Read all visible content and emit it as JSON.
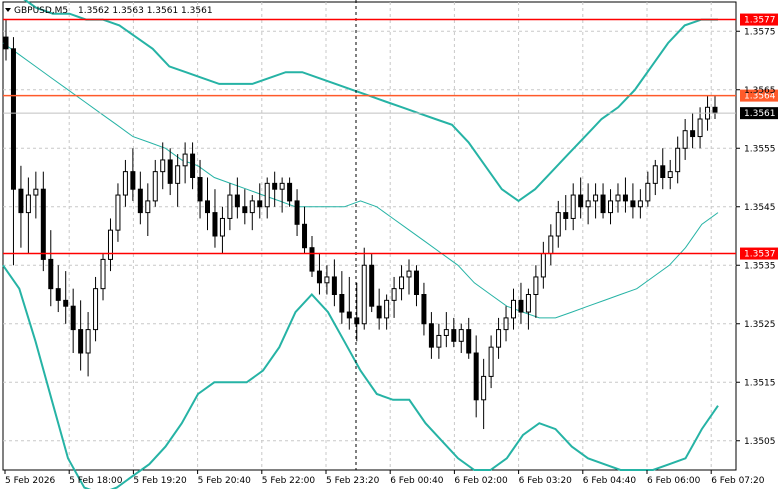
{
  "header": {
    "symbol": "GBPUSD,M5",
    "ohlc": "1.3562 1.3563 1.3561 1.3561"
  },
  "chart_data": {
    "type": "candlestick",
    "symbol": "GBPUSD",
    "timeframe": "M5",
    "ylim": [
      1.35,
      1.358
    ],
    "grid": true,
    "y_ticks": [
      "1.3575",
      "1.3565",
      "1.3555",
      "1.3545",
      "1.3535",
      "1.3525",
      "1.3515",
      "1.3505"
    ],
    "x_ticks": [
      "5 Feb 2026",
      "5 Feb 18:00",
      "5 Feb 19:20",
      "5 Feb 20:40",
      "5 Feb 22:00",
      "5 Feb 23:20",
      "6 Feb 00:40",
      "6 Feb 02:00",
      "6 Feb 03:20",
      "6 Feb 04:40",
      "6 Feb 06:00",
      "6 Feb 07:20"
    ],
    "horizontal_levels": [
      {
        "value": 1.3577,
        "label": "1.3577",
        "color": "#ff0000"
      },
      {
        "value": 1.3564,
        "label": "1.3564",
        "color": "#ff5a2a"
      },
      {
        "value": 1.3537,
        "label": "1.3537",
        "color": "#ff0000"
      }
    ],
    "bid_line": {
      "value": 1.3561,
      "label": "1.3561",
      "color": "#c0c0c0"
    },
    "candle_colors": {
      "body": "#000000",
      "wick": "#000000",
      "bull_fill": "#ffffff"
    },
    "indicators": {
      "upper_band": {
        "color": "#26b3a5",
        "values": [
          1.3583,
          1.3581,
          1.3579,
          1.3578,
          1.3578,
          1.3577,
          1.3577,
          1.3576,
          1.3574,
          1.3572,
          1.3569,
          1.3568,
          1.3567,
          1.3566,
          1.3566,
          1.3566,
          1.3567,
          1.3568,
          1.3568,
          1.3567,
          1.3566,
          1.3565,
          1.3564,
          1.3563,
          1.3562,
          1.3561,
          1.356,
          1.3559,
          1.3556,
          1.3552,
          1.3548,
          1.3546,
          1.3548,
          1.3551,
          1.3554,
          1.3557,
          1.356,
          1.3562,
          1.3565,
          1.3569,
          1.3573,
          1.3576,
          1.3577,
          1.3577
        ]
      },
      "middle_band": {
        "color": "#26b3a5",
        "values": [
          1.3573,
          1.3571,
          1.3569,
          1.3567,
          1.3565,
          1.3563,
          1.3561,
          1.3559,
          1.3557,
          1.3556,
          1.3555,
          1.3553,
          1.3552,
          1.355,
          1.3549,
          1.3548,
          1.3547,
          1.3546,
          1.3545,
          1.3545,
          1.3545,
          1.3545,
          1.3546,
          1.3545,
          1.3543,
          1.3541,
          1.3539,
          1.3537,
          1.3535,
          1.3532,
          1.353,
          1.3528,
          1.3527,
          1.3526,
          1.3526,
          1.3527,
          1.3528,
          1.3529,
          1.353,
          1.3531,
          1.3533,
          1.3535,
          1.3538,
          1.3542,
          1.3544
        ]
      },
      "lower_band": {
        "color": "#26b3a5",
        "values": [
          1.3535,
          1.3531,
          1.3522,
          1.3512,
          1.3502,
          1.3497,
          1.3496,
          1.3497,
          1.3499,
          1.3501,
          1.3504,
          1.3508,
          1.3513,
          1.3515,
          1.3515,
          1.3515,
          1.3517,
          1.3521,
          1.3527,
          1.353,
          1.3527,
          1.3522,
          1.3517,
          1.3513,
          1.3512,
          1.3512,
          1.3508,
          1.3505,
          1.3502,
          1.35,
          1.35,
          1.3502,
          1.3506,
          1.3508,
          1.3507,
          1.3504,
          1.3502,
          1.3501,
          1.35,
          1.35,
          1.35,
          1.3501,
          1.3502,
          1.3507,
          1.3511
        ]
      }
    },
    "candles": [
      [
        1.3574,
        1.3577,
        1.357,
        1.3572
      ],
      [
        1.3572,
        1.3574,
        1.3535,
        1.3548
      ],
      [
        1.3548,
        1.3552,
        1.3538,
        1.3544
      ],
      [
        1.3544,
        1.355,
        1.3537,
        1.3547
      ],
      [
        1.3547,
        1.3551,
        1.3543,
        1.3548
      ],
      [
        1.3548,
        1.3551,
        1.3534,
        1.3536
      ],
      [
        1.3536,
        1.3541,
        1.3528,
        1.3531
      ],
      [
        1.3531,
        1.3535,
        1.3527,
        1.3529
      ],
      [
        1.3529,
        1.3534,
        1.3525,
        1.3528
      ],
      [
        1.3528,
        1.3531,
        1.352,
        1.3524
      ],
      [
        1.3524,
        1.3529,
        1.3517,
        1.352
      ],
      [
        1.352,
        1.3527,
        1.3516,
        1.3524
      ],
      [
        1.3524,
        1.3533,
        1.3522,
        1.3531
      ],
      [
        1.3531,
        1.3537,
        1.3529,
        1.3536
      ],
      [
        1.3536,
        1.3543,
        1.3534,
        1.3541
      ],
      [
        1.3541,
        1.3549,
        1.3539,
        1.3547
      ],
      [
        1.3547,
        1.3553,
        1.3545,
        1.3551
      ],
      [
        1.3551,
        1.3555,
        1.3546,
        1.3548
      ],
      [
        1.3548,
        1.3551,
        1.3542,
        1.3544
      ],
      [
        1.3544,
        1.3549,
        1.354,
        1.3546
      ],
      [
        1.3546,
        1.3553,
        1.3545,
        1.3551
      ],
      [
        1.3551,
        1.3556,
        1.3548,
        1.3553
      ],
      [
        1.3553,
        1.3555,
        1.3547,
        1.3549
      ],
      [
        1.3549,
        1.3554,
        1.3545,
        1.3552
      ],
      [
        1.3552,
        1.3556,
        1.3549,
        1.3554
      ],
      [
        1.3554,
        1.3556,
        1.3548,
        1.355
      ],
      [
        1.355,
        1.3553,
        1.3543,
        1.3546
      ],
      [
        1.3546,
        1.355,
        1.3541,
        1.3544
      ],
      [
        1.3544,
        1.3548,
        1.3538,
        1.354
      ],
      [
        1.354,
        1.3545,
        1.3537,
        1.3543
      ],
      [
        1.3543,
        1.3549,
        1.3541,
        1.3547
      ],
      [
        1.3547,
        1.355,
        1.3543,
        1.3545
      ],
      [
        1.3545,
        1.3548,
        1.3542,
        1.3544
      ],
      [
        1.3544,
        1.3547,
        1.3541,
        1.3546
      ],
      [
        1.3546,
        1.3549,
        1.3543,
        1.3545
      ],
      [
        1.3545,
        1.355,
        1.3543,
        1.3549
      ],
      [
        1.3549,
        1.3551,
        1.3545,
        1.3548
      ],
      [
        1.3548,
        1.355,
        1.3544,
        1.3549
      ],
      [
        1.3549,
        1.355,
        1.3545,
        1.3546
      ],
      [
        1.3546,
        1.3548,
        1.354,
        1.3542
      ],
      [
        1.3542,
        1.3545,
        1.3537,
        1.3538
      ],
      [
        1.3538,
        1.354,
        1.3533,
        1.3534
      ],
      [
        1.3534,
        1.3537,
        1.353,
        1.3532
      ],
      [
        1.3532,
        1.3535,
        1.353,
        1.3533
      ],
      [
        1.3533,
        1.3536,
        1.3528,
        1.353
      ],
      [
        1.353,
        1.3534,
        1.3525,
        1.3527
      ],
      [
        1.3527,
        1.3533,
        1.3524,
        1.3526
      ],
      [
        1.3526,
        1.3532,
        1.3522,
        1.3525
      ],
      [
        1.3525,
        1.3538,
        1.3524,
        1.3535
      ],
      [
        1.3535,
        1.3537,
        1.3527,
        1.3528
      ],
      [
        1.3528,
        1.3531,
        1.3524,
        1.3526
      ],
      [
        1.3526,
        1.353,
        1.3524,
        1.3529
      ],
      [
        1.3529,
        1.3533,
        1.3526,
        1.3531
      ],
      [
        1.3531,
        1.3535,
        1.3529,
        1.3533
      ],
      [
        1.3533,
        1.3536,
        1.353,
        1.3534
      ],
      [
        1.3534,
        1.3535,
        1.3528,
        1.353
      ],
      [
        1.353,
        1.3532,
        1.3523,
        1.3525
      ],
      [
        1.3525,
        1.3527,
        1.3519,
        1.3521
      ],
      [
        1.3521,
        1.3525,
        1.3519,
        1.3523
      ],
      [
        1.3523,
        1.3527,
        1.3521,
        1.3524
      ],
      [
        1.3524,
        1.3526,
        1.3521,
        1.3522
      ],
      [
        1.3522,
        1.3525,
        1.352,
        1.3524
      ],
      [
        1.3524,
        1.3526,
        1.3519,
        1.352
      ],
      [
        1.352,
        1.3523,
        1.3509,
        1.3512
      ],
      [
        1.3512,
        1.3519,
        1.3507,
        1.3516
      ],
      [
        1.3516,
        1.3523,
        1.3514,
        1.3521
      ],
      [
        1.3521,
        1.3526,
        1.3519,
        1.3524
      ],
      [
        1.3524,
        1.3528,
        1.3522,
        1.3526
      ],
      [
        1.3526,
        1.3531,
        1.3524,
        1.3529
      ],
      [
        1.3529,
        1.3532,
        1.3525,
        1.3527
      ],
      [
        1.3527,
        1.3531,
        1.3524,
        1.353
      ],
      [
        1.353,
        1.3535,
        1.3526,
        1.3533
      ],
      [
        1.3533,
        1.3539,
        1.3531,
        1.3537
      ],
      [
        1.3537,
        1.3542,
        1.3535,
        1.354
      ],
      [
        1.354,
        1.3546,
        1.3538,
        1.3544
      ],
      [
        1.3544,
        1.3547,
        1.3541,
        1.3543
      ],
      [
        1.3543,
        1.3549,
        1.3541,
        1.3547
      ],
      [
        1.3547,
        1.355,
        1.3543,
        1.3545
      ],
      [
        1.3545,
        1.3549,
        1.3542,
        1.3546
      ],
      [
        1.3546,
        1.3549,
        1.3543,
        1.3547
      ],
      [
        1.3547,
        1.3549,
        1.3543,
        1.3544
      ],
      [
        1.3544,
        1.3548,
        1.3542,
        1.3546
      ],
      [
        1.3546,
        1.3549,
        1.3544,
        1.3547
      ],
      [
        1.3547,
        1.355,
        1.3544,
        1.3546
      ],
      [
        1.3546,
        1.3549,
        1.3543,
        1.3545
      ],
      [
        1.3545,
        1.3548,
        1.3543,
        1.3546
      ],
      [
        1.3546,
        1.3551,
        1.3545,
        1.3549
      ],
      [
        1.3549,
        1.3553,
        1.3547,
        1.3552
      ],
      [
        1.3552,
        1.3555,
        1.3548,
        1.355
      ],
      [
        1.355,
        1.3553,
        1.3548,
        1.3551
      ],
      [
        1.3551,
        1.3557,
        1.3549,
        1.3555
      ],
      [
        1.3555,
        1.356,
        1.3553,
        1.3558
      ],
      [
        1.3558,
        1.3561,
        1.3555,
        1.3557
      ],
      [
        1.3557,
        1.3562,
        1.3555,
        1.356
      ],
      [
        1.356,
        1.3564,
        1.3558,
        1.3562
      ],
      [
        1.3562,
        1.3564,
        1.356,
        1.3561
      ]
    ]
  }
}
